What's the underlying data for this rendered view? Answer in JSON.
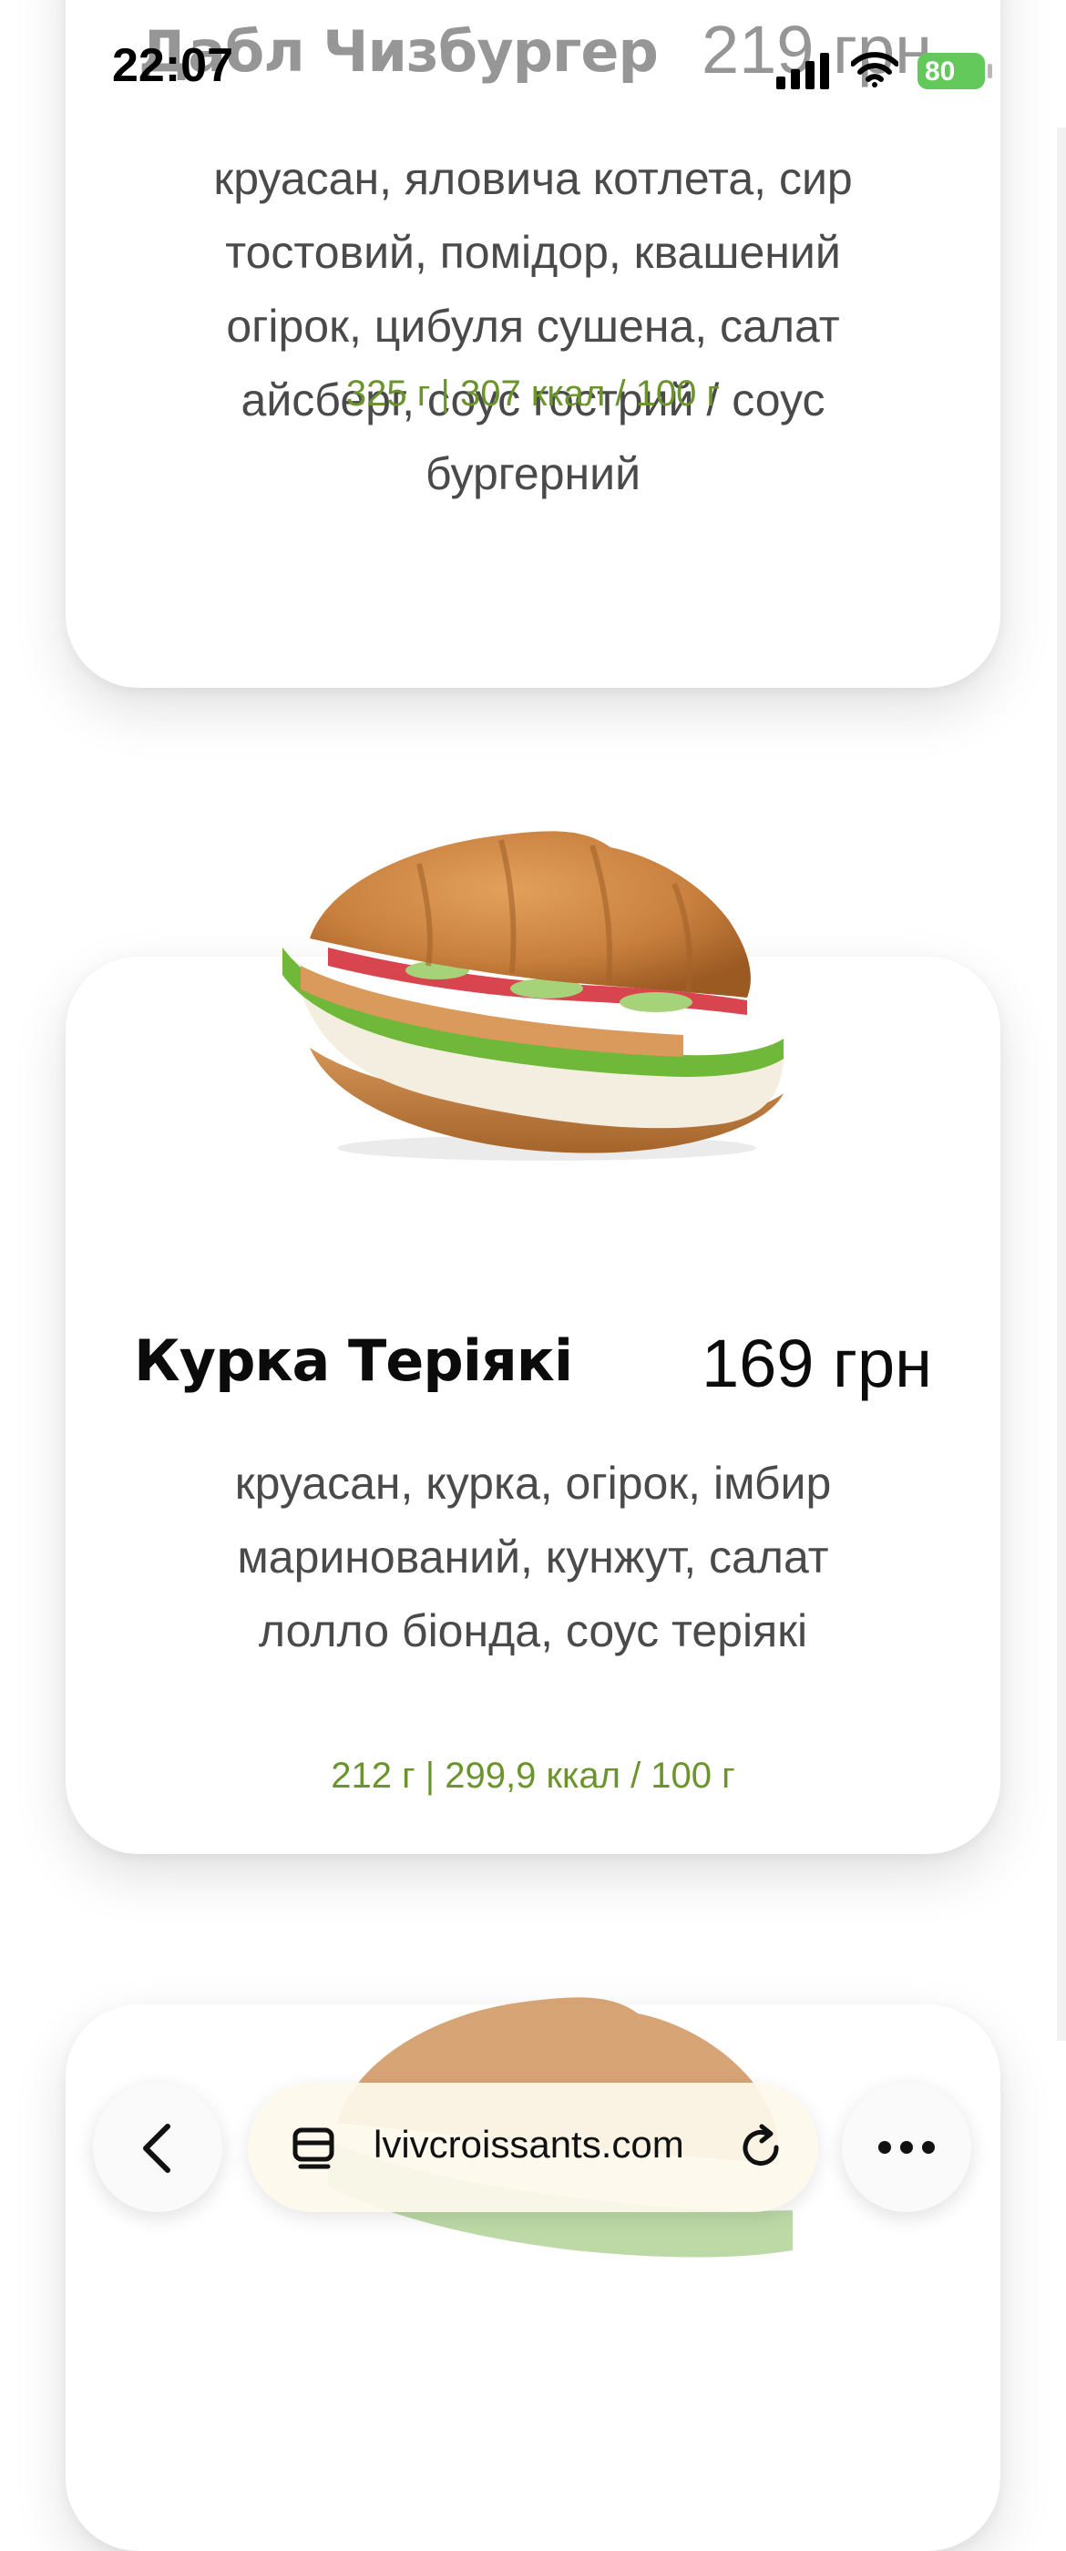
{
  "status_bar": {
    "time": "22:07",
    "battery": "80"
  },
  "items": [
    {
      "name": "Дабл Чизбургер",
      "price": "219 грн",
      "description": "круасан, яловича котлета, сир тостовий, помідор, квашений огірок, цибуля сушена, салат айсберг, соус гострий / соус бургерний",
      "nutrition": "325 г | 307 ккал / 100 г"
    },
    {
      "name": "Курка Теріякі",
      "price": "169 грн",
      "description": "круасан, курка, огірок, імбир маринований, кунжут, салат лолло біонда, соус теріякі",
      "nutrition": "212 г | 299,9 ккал / 100 г"
    }
  ],
  "browser": {
    "url": "lvivcroissants.com"
  },
  "colors": {
    "accent_green": "#6b942c",
    "battery_green": "#63c95b"
  }
}
